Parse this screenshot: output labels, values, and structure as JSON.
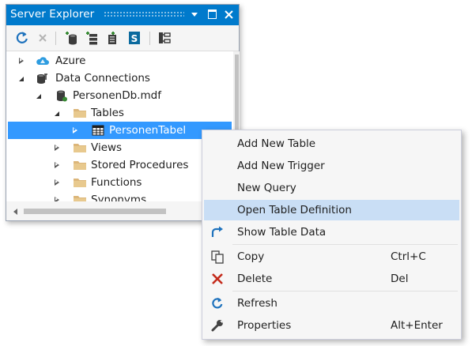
{
  "panel": {
    "title": "Server Explorer"
  },
  "toolbar": {
    "icons": [
      "refresh-icon",
      "stop-icon",
      "connect-database-icon",
      "connect-server-icon",
      "add-sharepoint-connection-icon",
      "sharepoint-icon",
      "view-class-diagram-icon"
    ]
  },
  "tree": {
    "nodes": [
      {
        "label": "Azure",
        "icon": "azure-cloud-icon",
        "state": "collapsed"
      },
      {
        "label": "Data Connections",
        "icon": "data-connections-icon",
        "state": "expanded"
      },
      {
        "label": "PersonenDb.mdf",
        "icon": "database-icon",
        "state": "expanded"
      },
      {
        "label": "Tables",
        "icon": "folder-icon",
        "state": "expanded"
      },
      {
        "label": "PersonenTabel",
        "icon": "table-icon",
        "state": "collapsed",
        "selected": true
      },
      {
        "label": "Views",
        "icon": "folder-icon",
        "state": "collapsed"
      },
      {
        "label": "Stored Procedures",
        "icon": "folder-icon",
        "state": "collapsed"
      },
      {
        "label": "Functions",
        "icon": "folder-icon",
        "state": "collapsed"
      },
      {
        "label": "Synonyms",
        "icon": "folder-icon",
        "state": "collapsed"
      }
    ]
  },
  "context_menu": {
    "items": [
      {
        "label": "Add New Table",
        "shortcut": "",
        "icon": ""
      },
      {
        "label": "Add New Trigger",
        "shortcut": "",
        "icon": ""
      },
      {
        "label": "New Query",
        "shortcut": "",
        "icon": ""
      },
      {
        "label": "Open Table Definition",
        "shortcut": "",
        "icon": "",
        "highlighted": true
      },
      {
        "label": "Show Table Data",
        "shortcut": "",
        "icon": "show-table-data-arrow-icon"
      },
      {
        "label": "Copy",
        "shortcut": "Ctrl+C",
        "icon": "copy-icon"
      },
      {
        "label": "Delete",
        "shortcut": "Del",
        "icon": "delete-x-icon"
      },
      {
        "label": "Refresh",
        "shortcut": "",
        "icon": "refresh-icon"
      },
      {
        "label": "Properties",
        "shortcut": "Alt+Enter",
        "icon": "wrench-icon"
      }
    ]
  },
  "colors": {
    "accent": "#007acc",
    "selection": "#3399ff",
    "menu_highlight": "#c9def5",
    "delete_red": "#c42b1c",
    "icon_blue": "#1e72bd"
  }
}
